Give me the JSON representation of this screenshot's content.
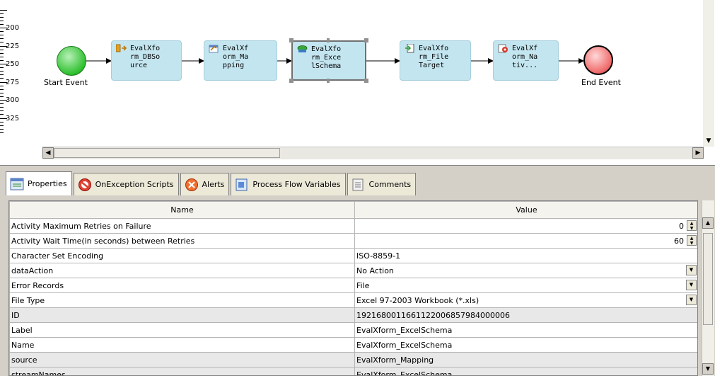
{
  "ruler": {
    "labels": [
      "200",
      "225",
      "250",
      "275",
      "300",
      "325"
    ]
  },
  "flow": {
    "start_event": "Start Event",
    "end_event": "End Event",
    "nodes": [
      {
        "label": "EvalXfo\nrm_DBSo\nurce",
        "icon": "db-source-icon"
      },
      {
        "label": "EvalXf\norm_Ma\npping",
        "icon": "mapping-icon"
      },
      {
        "label": "EvalXfo\nrm_Exce\nlSchema",
        "icon": "excel-schema-icon"
      },
      {
        "label": "EvalXfo\nrm_File\nTarget",
        "icon": "file-target-icon"
      },
      {
        "label": "EvalXf\norm_Na\ntiv...",
        "icon": "native-icon"
      }
    ]
  },
  "tabs": [
    {
      "label": "Properties",
      "icon": "properties-icon"
    },
    {
      "label": "OnException Scripts",
      "icon": "exception-icon"
    },
    {
      "label": "Alerts",
      "icon": "alerts-icon"
    },
    {
      "label": "Process Flow Variables",
      "icon": "variables-icon"
    },
    {
      "label": "Comments",
      "icon": "comments-icon"
    }
  ],
  "table": {
    "headers": {
      "name": "Name",
      "value": "Value"
    },
    "rows": [
      {
        "name": "Activity Maximum Retries on Failure",
        "value": "0"
      },
      {
        "name": "Activity Wait Time(in seconds) between Retries",
        "value": "60"
      },
      {
        "name": "Character Set Encoding",
        "value": "ISO-8859-1"
      },
      {
        "name": "dataAction",
        "value": "No Action"
      },
      {
        "name": "Error Records",
        "value": "File"
      },
      {
        "name": "File Type",
        "value": "Excel 97-2003 Workbook (*.xls)"
      },
      {
        "name": "ID",
        "value": "1921680011661122006857984000006"
      },
      {
        "name": "Label",
        "value": "EvalXform_ExcelSchema"
      },
      {
        "name": "Name",
        "value": "EvalXform_ExcelSchema"
      },
      {
        "name": "source",
        "value": "EvalXform_Mapping"
      },
      {
        "name": "streamNames",
        "value": "EvalXform_ExcelSchema"
      }
    ]
  }
}
